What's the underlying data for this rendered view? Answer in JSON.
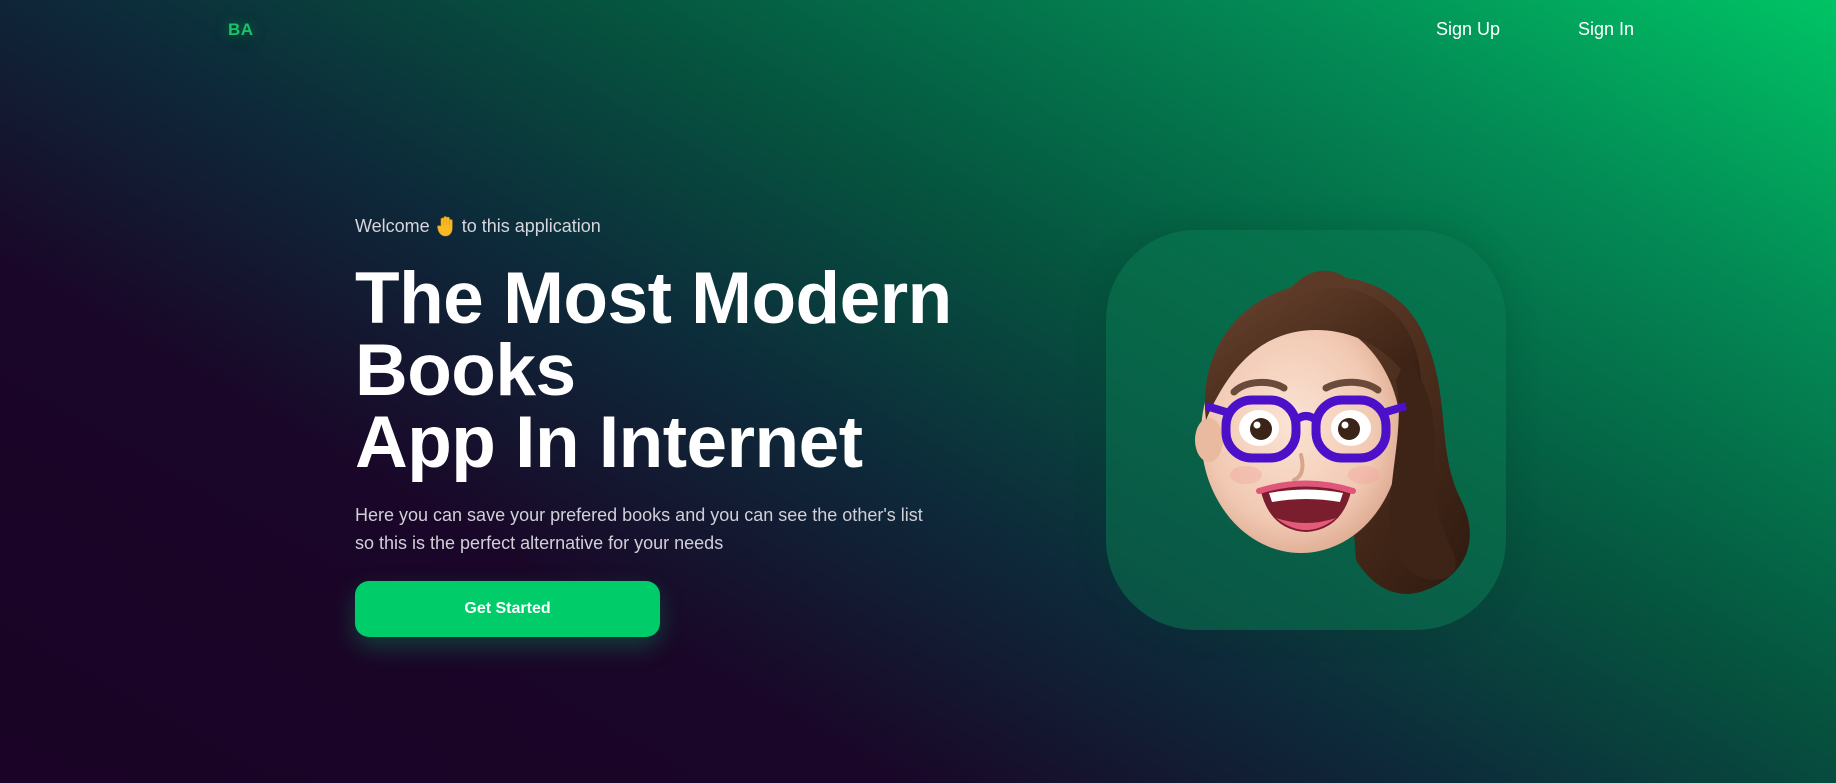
{
  "header": {
    "logo": "BA",
    "nav": {
      "sign_up": "Sign Up",
      "sign_in": "Sign In"
    }
  },
  "hero": {
    "welcome_before": "Welcome",
    "welcome_icon": "raised-hand-icon",
    "welcome_after": "to this application",
    "headline": {
      "line1": "The Most Modern",
      "line2": "Books",
      "line3": "App In Internet"
    },
    "description": {
      "line1": "Here you can save your prefered books and you can see the other's list",
      "line2": "so this is the perfect alternative for your needs"
    },
    "cta_label": "Get Started"
  },
  "avatar": {
    "icon": "memoji-avatar-icon"
  },
  "colors": {
    "accent": "#00cc6a",
    "logo": "#19c468",
    "background_dark": "#1a0326",
    "background_green": "#00c465"
  }
}
